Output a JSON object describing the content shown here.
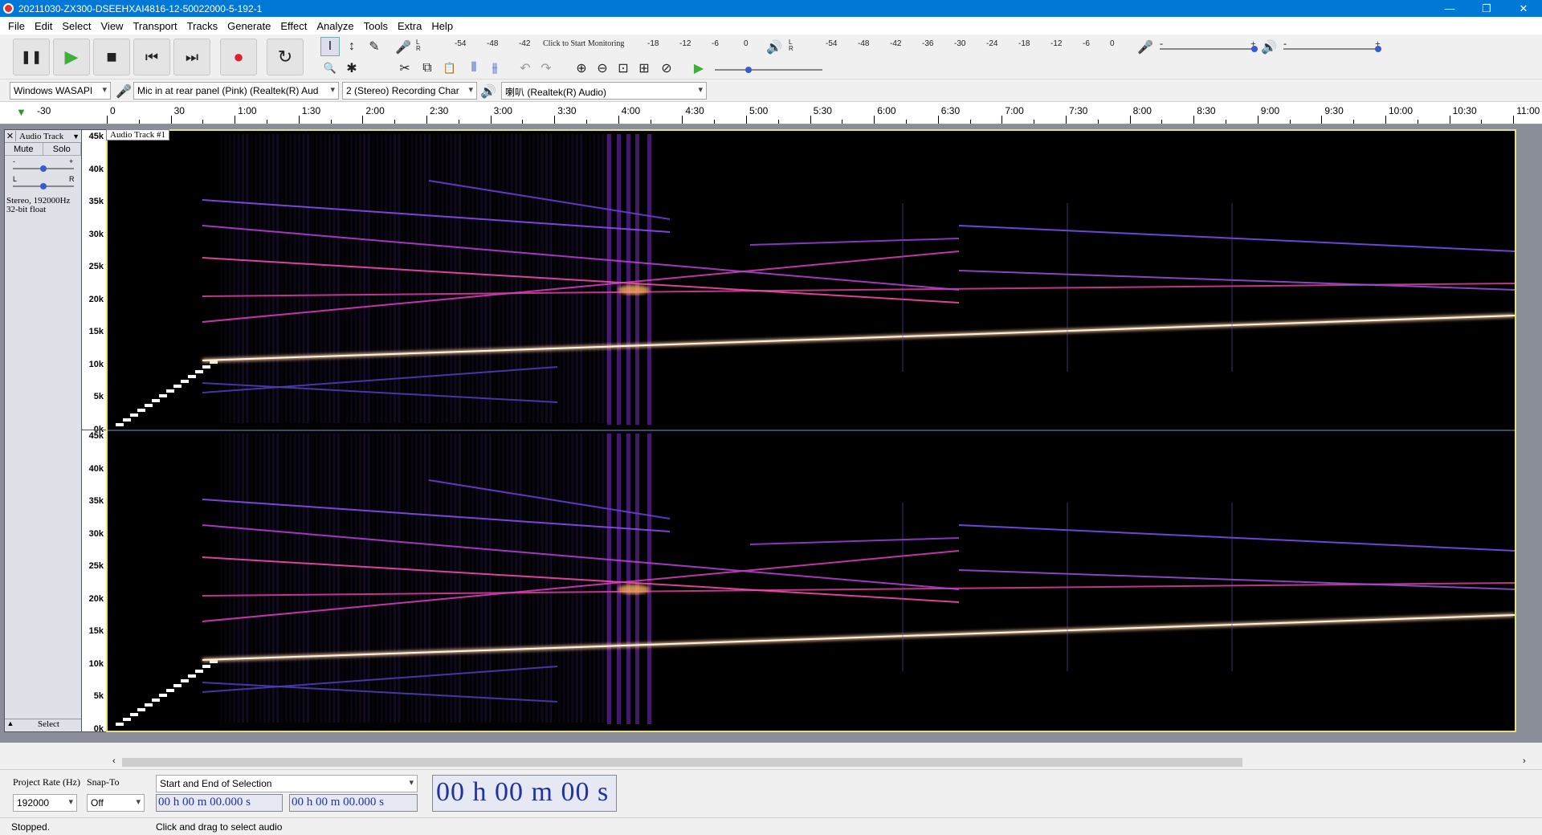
{
  "window": {
    "title": "20211030-ZX300-DSEEHXAI4816-12-50022000-5-192-1",
    "min": "—",
    "max": "❐",
    "close": "✕"
  },
  "menu": [
    "File",
    "Edit",
    "Select",
    "View",
    "Transport",
    "Tracks",
    "Generate",
    "Effect",
    "Analyze",
    "Tools",
    "Extra",
    "Help"
  ],
  "transport": {
    "pause": "❚❚",
    "play": "▶",
    "stop": "■",
    "skip_start": "⏮",
    "skip_end": "⏭",
    "record": "●",
    "loop": "↻"
  },
  "colors": {
    "play": "#3fae3a",
    "record": "#e0202c",
    "accent": "#0078d7"
  },
  "tools": {
    "select": "I",
    "envelope": "↕",
    "draw": "✎",
    "zoom": "🔍",
    "multi": "✱"
  },
  "edit_tools": {
    "cut": "✂",
    "copy": "⧉",
    "paste": "📋",
    "trim": "⫴",
    "silence": "⫵",
    "undo": "↶",
    "redo": "↷",
    "zoom_in": "⊕",
    "zoom_out": "⊖",
    "fit_sel": "⊡",
    "fit_proj": "⊞",
    "zoom_toggle": "⊘",
    "play_at_speed": "▶"
  },
  "recording_meter": {
    "scale": [
      "-54",
      "-48",
      "-42",
      "-18",
      "-12",
      "-6",
      "0"
    ],
    "monitor_text": "Click to Start Monitoring",
    "lr": [
      "L",
      "R"
    ]
  },
  "playback_meter": {
    "scale": [
      "-54",
      "-48",
      "-42",
      "-36",
      "-30",
      "-24",
      "-18",
      "-12",
      "-6",
      "0"
    ],
    "lr": [
      "L",
      "R"
    ]
  },
  "mixer": {
    "rec_minus": "-",
    "rec_plus": "+",
    "play_minus": "-",
    "play_plus": "+",
    "rec_level": 1.0,
    "play_level": 1.0
  },
  "devices": {
    "host": "Windows WASAPI",
    "rec_device": "Mic in at rear panel (Pink) (Realtek(R) Aud",
    "channels": "2 (Stereo) Recording Char",
    "play_device": "喇叭 (Realtek(R) Audio)"
  },
  "ruler": {
    "start": "-30",
    "ticks": [
      "0",
      "30",
      "1:00",
      "1:30",
      "2:00",
      "2:30",
      "3:00",
      "3:30",
      "4:00",
      "4:30",
      "5:00",
      "5:30",
      "6:00",
      "6:30",
      "7:00",
      "7:30",
      "8:00",
      "8:30",
      "9:00",
      "9:30",
      "10:00",
      "10:30",
      "11:00"
    ]
  },
  "track": {
    "name": "Audio Track #1",
    "control_name": "Audio Track",
    "mute": "Mute",
    "solo": "Solo",
    "gain_minus": "-",
    "gain_plus": "+",
    "pan_l": "L",
    "pan_r": "R",
    "info1": "Stereo, 192000Hz",
    "info2": "32-bit float",
    "select": "Select",
    "collapse": "▲",
    "close": "✕"
  },
  "freq_scale": [
    "45k",
    "40k",
    "35k",
    "30k",
    "25k",
    "20k",
    "15k",
    "10k",
    "5k",
    "0k"
  ],
  "selection": {
    "project_rate_label": "Project Rate (Hz)",
    "project_rate": "192000",
    "snap_label": "Snap-To",
    "snap_value": "Off",
    "mode": "Start and End of Selection",
    "start": "00 h 00 m 00.000 s",
    "end": "00 h 00 m 00.000 s",
    "time": "00 h 00 m 00 s"
  },
  "status": {
    "state": "Stopped.",
    "hint": "Click and drag to select audio"
  }
}
